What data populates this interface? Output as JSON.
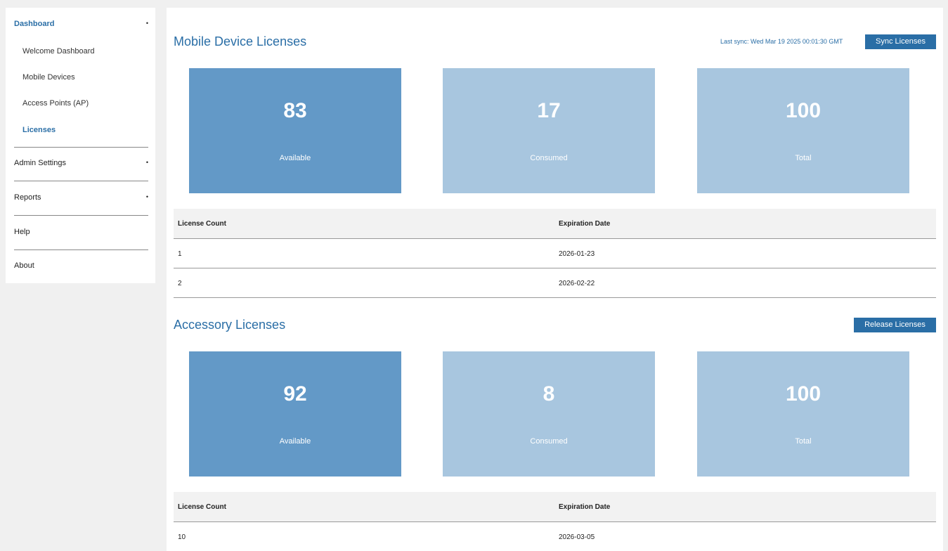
{
  "sidebar": {
    "dashboard": {
      "label": "Dashboard",
      "caret": "•"
    },
    "items": [
      {
        "label": "Welcome Dashboard"
      },
      {
        "label": "Mobile Devices"
      },
      {
        "label": "Access Points (AP)"
      },
      {
        "label": "Licenses"
      }
    ],
    "admin_settings": {
      "label": "Admin Settings",
      "caret": "•"
    },
    "reports": {
      "label": "Reports",
      "caret": "•"
    },
    "help": {
      "label": "Help"
    },
    "about": {
      "label": "About"
    }
  },
  "mobile": {
    "title": "Mobile Device Licenses",
    "last_sync": "Last sync: Wed Mar 19 2025 00:01:30 GMT",
    "sync_button": "Sync Licenses",
    "tiles": [
      {
        "value": "83",
        "label": "Available"
      },
      {
        "value": "17",
        "label": "Consumed"
      },
      {
        "value": "100",
        "label": "Total"
      }
    ],
    "table": {
      "headers": [
        "License Count",
        "Expiration Date"
      ],
      "rows": [
        [
          "1",
          "2026-01-23"
        ],
        [
          "2",
          "2026-02-22"
        ]
      ]
    }
  },
  "accessory": {
    "title": "Accessory Licenses",
    "release_button": "Release Licenses",
    "tiles": [
      {
        "value": "92",
        "label": "Available"
      },
      {
        "value": "8",
        "label": "Consumed"
      },
      {
        "value": "100",
        "label": "Total"
      }
    ],
    "table": {
      "headers": [
        "License Count",
        "Expiration Date"
      ],
      "rows": [
        [
          "10",
          "2026-03-05"
        ]
      ]
    }
  },
  "colors": {
    "accent": "#2a6ea6",
    "tile_dark": "#6399c7",
    "tile_light": "#a8c6df"
  }
}
